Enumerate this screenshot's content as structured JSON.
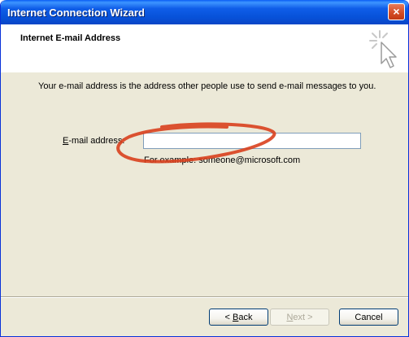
{
  "window": {
    "title": "Internet Connection Wizard",
    "close_label": "×"
  },
  "header": {
    "title": "Internet E-mail Address"
  },
  "body": {
    "intro": "Your e-mail address is the address other people use to send e-mail messages to you.",
    "email_label_mnemonic": "E",
    "email_label_rest": "-mail address:",
    "email_value": "",
    "example": "For example: someone@microsoft.com"
  },
  "buttons": {
    "back_prefix": "< ",
    "back_mnemonic": "B",
    "back_rest": "ack",
    "next_mnemonic": "N",
    "next_rest": "ext >",
    "cancel": "Cancel"
  },
  "colors": {
    "titlebar": "#0752d9",
    "face": "#ece9d8",
    "annotation": "#d9401e"
  },
  "icons": {
    "header": "wizard-sparkle-cursor-icon",
    "close": "close-icon"
  }
}
